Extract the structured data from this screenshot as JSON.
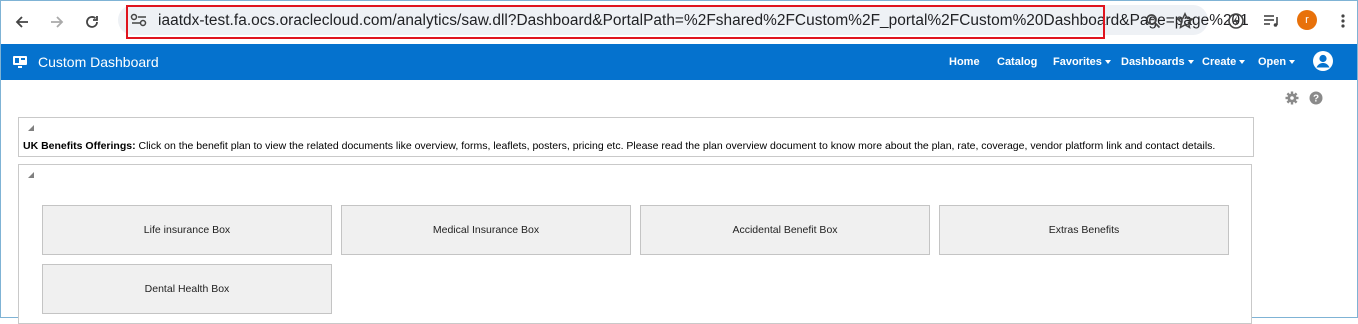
{
  "browser": {
    "url": "iaatdx-test.fa.ocs.oraclecloud.com/analytics/saw.dll?Dashboard&PortalPath=%2Fshared%2FCustom%2F_portal%2FCustom%20Dashboard&Page=page%201",
    "profile_initial": "r"
  },
  "header": {
    "title": "Custom Dashboard",
    "nav": [
      "Home",
      "Catalog",
      "Favorites",
      "Dashboards",
      "Create",
      "Open"
    ]
  },
  "intro": {
    "bold_label": "UK Benefits Offerings:",
    "text": " Click on the benefit plan to view the related documents like overview, forms, leaflets, posters, pricing etc. Please read the plan overview document to know more about the plan, rate, coverage, vendor platform link and contact details."
  },
  "benefits": [
    "Life insurance Box",
    "Medical Insurance Box",
    "Accidental Benefit Box",
    "Extras Benefits",
    "Dental Health Box"
  ],
  "colors": {
    "header_blue": "#0572ce",
    "url_highlight": "#e0141e"
  }
}
